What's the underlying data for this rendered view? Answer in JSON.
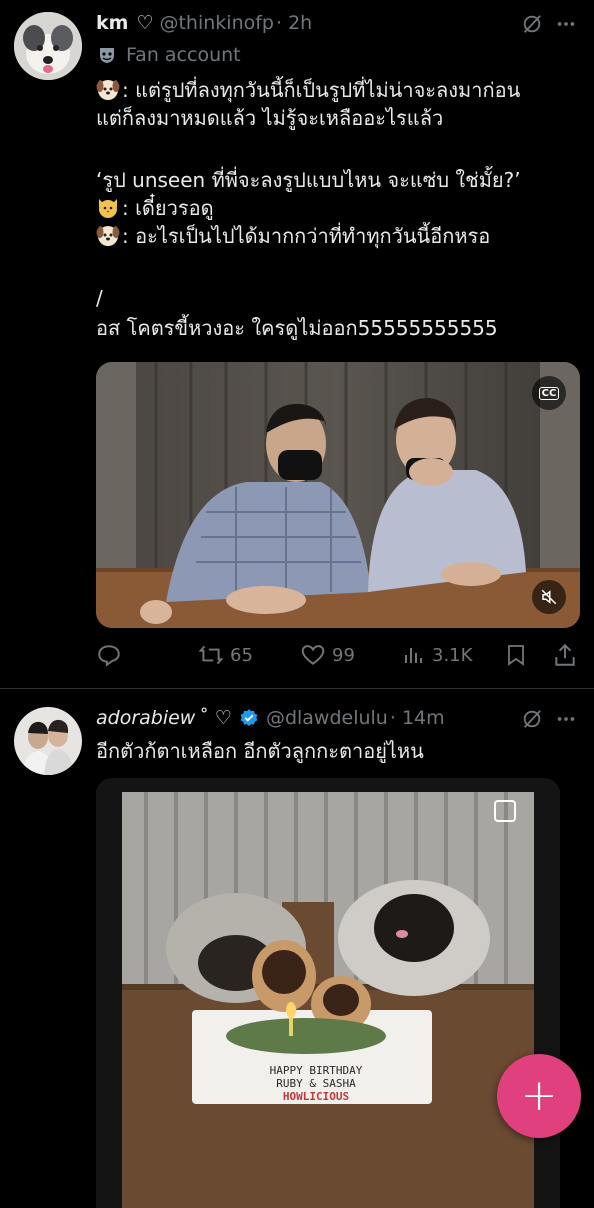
{
  "tweet1": {
    "display_name": "km",
    "heart_glyph": "♡",
    "handle": "@thinkinofp",
    "time": "· 2h",
    "label": "Fan account",
    "lines": [
      ": แต่รูปที่ลงทุกวันนี้ก็เป็นรูปที่ไม่น่าจะลงมาก่อน",
      "แต่ก็ลงมาหมดแล้ว ไม่รู้จะเหลืออะไรแล้ว",
      "",
      "‘รูป unseen ที่พี่จะลงรูปแบบไหน จะแซ่บ ใช่มั้ย?’",
      ": เดี๋ยวรอดู",
      ": อะไรเป็นไปได้มากกว่าที่ทำทุกวันนี้อีกหรอ",
      "",
      "/",
      "อส โคตรขี้หวงอะ ใครดูไม่ออก55555555555"
    ],
    "line_emojis": [
      "dog-face",
      "",
      "",
      "",
      "cat-face",
      "dog-face",
      "",
      "",
      ""
    ],
    "retweets": "65",
    "likes": "99",
    "views": "3.1K"
  },
  "tweet2": {
    "display_name": "adorabiew",
    "name_suffix": "˚ ♡",
    "handle": "@dlawdelulu",
    "time": "· 14m",
    "text": "อีกตัวก้ตาเหลือก อีกตัวลูกกะตาอยู่ไหน",
    "cake_text": [
      "HAPPY BIRTHDAY",
      "RUBY & SASHA",
      "HOWLICIOUS"
    ]
  },
  "icons": {
    "grok": "grok-icon",
    "more": "more-icon",
    "fan": "theater-mask-icon",
    "cc": "CC",
    "reply": "reply-icon",
    "retweet": "retweet-icon",
    "like": "heart-icon",
    "views": "views-icon",
    "bookmark": "bookmark-icon",
    "share": "share-icon",
    "compose": "+"
  },
  "colors": {
    "accent": "#e0407d",
    "verified": "#1d9bf0",
    "muted": "#71767b"
  }
}
